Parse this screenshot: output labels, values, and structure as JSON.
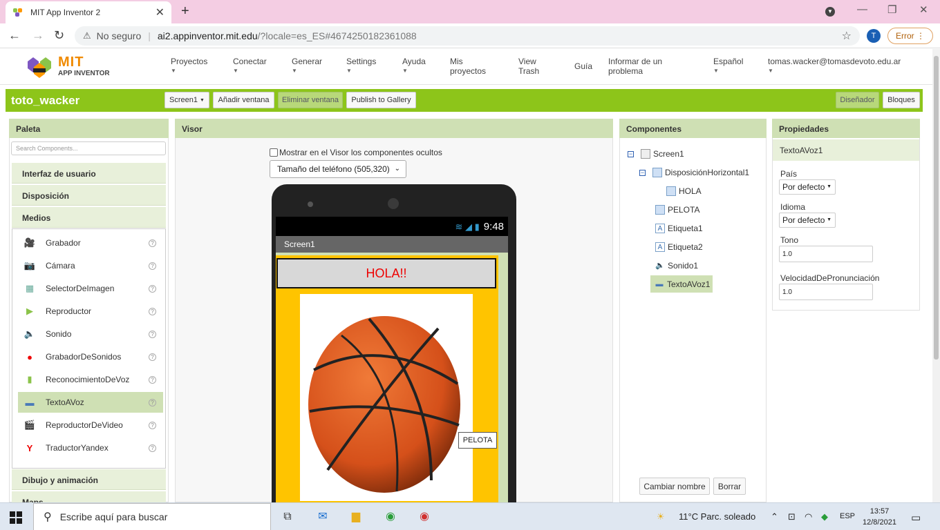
{
  "browser": {
    "tab_title": "MIT App Inventor 2",
    "security": "No seguro",
    "url_host": "ai2.appinventor.mit.edu",
    "url_path": "/?locale=es_ES#4674250182361088",
    "profile_initial": "T",
    "error_label": "Error"
  },
  "header": {
    "logo_mit": "MIT",
    "logo_sub": "APP INVENTOR",
    "menus": [
      "Proyectos",
      "Conectar",
      "Generar",
      "Settings",
      "Ayuda"
    ],
    "links": {
      "mis1": "Mis",
      "mis2": "proyectos",
      "view1": "View",
      "view2": "Trash",
      "guia": "Guía",
      "inf1": "Informar de un",
      "inf2": "problema"
    },
    "lang": "Español",
    "user": "tomas.wacker@tomasdevoto.edu.ar"
  },
  "project": {
    "name": "toto_wacker",
    "screen_select": "Screen1",
    "add_screen": "Añadir ventana",
    "remove_screen": "Eliminar ventana",
    "publish": "Publish to Gallery",
    "designer": "Diseñador",
    "blocks": "Bloques"
  },
  "palette": {
    "title": "Paleta",
    "search_placeholder": "Search Components...",
    "categories": [
      "Interfaz de usuario",
      "Disposición",
      "Medios",
      "Dibujo y animación",
      "Maps"
    ],
    "items": [
      "Grabador",
      "Cámara",
      "SelectorDeImagen",
      "Reproductor",
      "Sonido",
      "GrabadorDeSonidos",
      "ReconocimientoDeVoz",
      "TextoAVoz",
      "ReproductorDeVideo",
      "TraductorYandex"
    ],
    "help": "?"
  },
  "viewer": {
    "title": "Visor",
    "show_hidden": "Mostrar en el Visor los componentes ocultos",
    "phone_size": "Tamaño del teléfono (505,320)",
    "time": "9:48",
    "screen_title": "Screen1",
    "hola_text": "HOLA!!",
    "pelota_label": "PELOTA"
  },
  "components": {
    "title": "Componentes",
    "tree": [
      "Screen1",
      "DisposiciónHorizontal1",
      "HOLA",
      "PELOTA",
      "Etiqueta1",
      "Etiqueta2",
      "Sonido1",
      "TextoAVoz1"
    ],
    "rename": "Cambiar nombre",
    "delete": "Borrar"
  },
  "properties": {
    "title": "Propiedades",
    "component": "TextoAVoz1",
    "country_label": "País",
    "country_value": "Por defecto",
    "language_label": "Idioma",
    "language_value": "Por defecto",
    "pitch_label": "Tono",
    "pitch_value": "1.0",
    "rate_label": "VelocidadDePronunciación",
    "rate_value": "1.0"
  },
  "taskbar": {
    "search": "Escribe aquí para buscar",
    "weather": "11°C  Parc. soleado",
    "lang": "ESP",
    "time": "13:57",
    "date": "12/8/2021"
  },
  "colors": {
    "accent_green": "#8dc51a",
    "panel_header": "#cfe0b4",
    "hola_red": "#e00000",
    "arrangement_yellow": "#ffc400"
  }
}
